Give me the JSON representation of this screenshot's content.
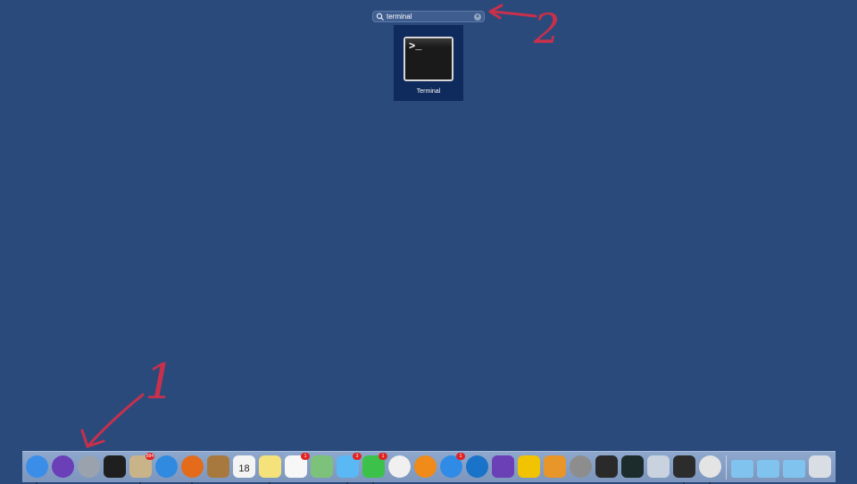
{
  "search": {
    "value": "terminal"
  },
  "result": {
    "label": "Terminal",
    "prompt_glyph": ">_"
  },
  "annotations": {
    "arrow_1_label": "1",
    "arrow_2_label": "2",
    "color": "#c8304b"
  },
  "dock": {
    "items": [
      {
        "name": "finder-icon",
        "running": true,
        "color": "#3b8ee8"
      },
      {
        "name": "siri-icon",
        "running": false,
        "color": "#6a3fb8"
      },
      {
        "name": "launchpad-icon",
        "running": false,
        "color": "#9aa3ad"
      },
      {
        "name": "terminal-icon",
        "running": false,
        "color": "#1f1f1f"
      },
      {
        "name": "preview-icon",
        "running": true,
        "badge": "584",
        "color": "#c9b48a"
      },
      {
        "name": "safari-icon",
        "running": false,
        "color": "#2f8ae0"
      },
      {
        "name": "firefox-icon",
        "running": true,
        "color": "#e36b1a"
      },
      {
        "name": "notebook-icon",
        "running": false,
        "color": "#a8793e"
      },
      {
        "name": "calendar-icon",
        "running": false,
        "color": "#f4f4f4",
        "text": "18"
      },
      {
        "name": "notes-icon",
        "running": true,
        "color": "#f5e27a"
      },
      {
        "name": "reminders-icon",
        "running": false,
        "badge": "1",
        "color": "#f7f7f7"
      },
      {
        "name": "maps-icon",
        "running": false,
        "color": "#7dc27a"
      },
      {
        "name": "messages-icon",
        "running": true,
        "badge": "3",
        "color": "#5ab8f5"
      },
      {
        "name": "facetime-icon",
        "running": true,
        "badge": "1",
        "color": "#3cc24a"
      },
      {
        "name": "itunes-icon",
        "running": false,
        "color": "#f0f0f0"
      },
      {
        "name": "ibooks-icon",
        "running": false,
        "color": "#f08a19"
      },
      {
        "name": "app-store-icon",
        "running": false,
        "badge": "1",
        "color": "#2f8be6"
      },
      {
        "name": "teamviewer-icon",
        "running": false,
        "color": "#1973c8"
      },
      {
        "name": "imovie-icon",
        "running": false,
        "color": "#6b3fb5"
      },
      {
        "name": "wunderlist-icon",
        "running": false,
        "color": "#f2c300"
      },
      {
        "name": "system-preferences-icon",
        "running": false,
        "color": "#e8952a"
      },
      {
        "name": "disk-utility-icon",
        "running": false,
        "color": "#8d8d8d"
      },
      {
        "name": "console-icon",
        "running": false,
        "color": "#2a2a2a"
      },
      {
        "name": "activity-monitor-icon",
        "running": false,
        "color": "#1c2c2c"
      },
      {
        "name": "virtualbox-icon",
        "running": false,
        "color": "#c9d3df"
      },
      {
        "name": "screen-sharing-icon",
        "running": true,
        "color": "#2c2c2c"
      },
      {
        "name": "chrome-icon",
        "running": true,
        "color": "#e4e4e4"
      },
      {
        "name": "applications-folder-icon",
        "running": false,
        "color": "#7fc3ee"
      },
      {
        "name": "documents-folder-icon",
        "running": false,
        "color": "#7fc3ee"
      },
      {
        "name": "downloads-folder-icon",
        "running": false,
        "color": "#7fc3ee"
      },
      {
        "name": "trash-icon",
        "running": false,
        "color": "#d9dee5"
      }
    ]
  }
}
